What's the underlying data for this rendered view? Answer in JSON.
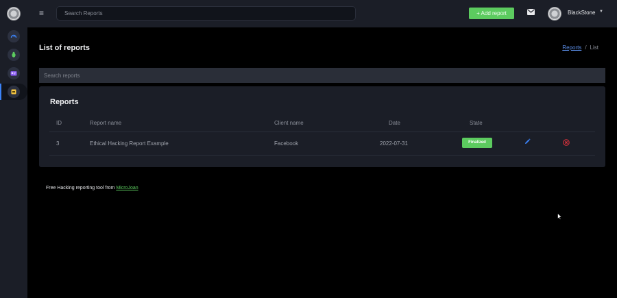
{
  "topbar": {
    "search_placeholder": "Search Reports",
    "add_report_label": "+ Add report",
    "user_name": "BlackStone"
  },
  "sidebar": {
    "items": [
      {
        "icon": "gauge-icon",
        "color": "#3b82f6"
      },
      {
        "icon": "bug-icon",
        "color": "#5ccb5f"
      },
      {
        "icon": "id-card-icon",
        "color": "#8b5cf6"
      },
      {
        "icon": "report-icon",
        "color": "#f5c542",
        "active": true
      }
    ]
  },
  "page": {
    "title": "List of reports",
    "breadcrumb": {
      "link": "Reports",
      "separator": "/",
      "current": "List"
    },
    "filter_placeholder": "Search reports"
  },
  "reports": {
    "title": "Reports",
    "columns": [
      "ID",
      "Report name",
      "Client name",
      "Date",
      "State"
    ],
    "rows": [
      {
        "id": "3",
        "report_name": "Ethical Hacking Report Example",
        "client_name": "Facebook",
        "date": "2022-07-31",
        "state": "Finalized"
      }
    ]
  },
  "footer": {
    "text": "Free Hacking reporting tool from ",
    "link": "MicroJoan"
  },
  "colors": {
    "accent_green": "#5ccb5f",
    "link_blue": "#5b8ee8",
    "danger_red": "#e0323c",
    "panel": "#1b1e27"
  }
}
